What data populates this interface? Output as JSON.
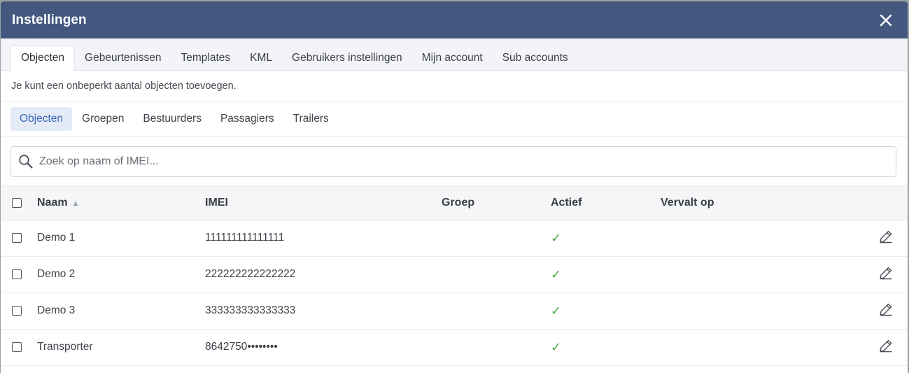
{
  "dialog": {
    "title": "Instellingen"
  },
  "tabs": [
    {
      "label": "Objecten",
      "active": true
    },
    {
      "label": "Gebeurtenissen"
    },
    {
      "label": "Templates"
    },
    {
      "label": "KML"
    },
    {
      "label": "Gebruikers instellingen"
    },
    {
      "label": "Mijn account"
    },
    {
      "label": "Sub accounts"
    }
  ],
  "info_text": "Je kunt een onbeperkt aantal objecten toevoegen.",
  "subtabs": [
    {
      "label": "Objecten",
      "active": true
    },
    {
      "label": "Groepen"
    },
    {
      "label": "Bestuurders"
    },
    {
      "label": "Passagiers"
    },
    {
      "label": "Trailers"
    }
  ],
  "search": {
    "placeholder": "Zoek op naam of IMEI...",
    "value": ""
  },
  "table": {
    "columns": {
      "name": "Naam",
      "imei": "IMEI",
      "groep": "Groep",
      "actief": "Actief",
      "vervalt": "Vervalt op"
    },
    "sort_indicator": "▲",
    "rows": [
      {
        "name": "Demo 1",
        "imei": "111111111111111",
        "groep": "",
        "actief": "✓",
        "vervalt": ""
      },
      {
        "name": "Demo 2",
        "imei": "222222222222222",
        "groep": "",
        "actief": "✓",
        "vervalt": ""
      },
      {
        "name": "Demo 3",
        "imei": "333333333333333",
        "groep": "",
        "actief": "✓",
        "vervalt": ""
      },
      {
        "name": "Transporter",
        "imei": "8642750••••••••",
        "groep": "",
        "actief": "✓",
        "vervalt": ""
      }
    ]
  },
  "colors": {
    "titlebar": "#43577f",
    "accent": "#3d68b9",
    "active_check": "#49a84a"
  },
  "icons": {
    "close": "close-icon",
    "search": "search-icon",
    "edit": "pencil-icon",
    "sort": "sort-asc-icon"
  }
}
